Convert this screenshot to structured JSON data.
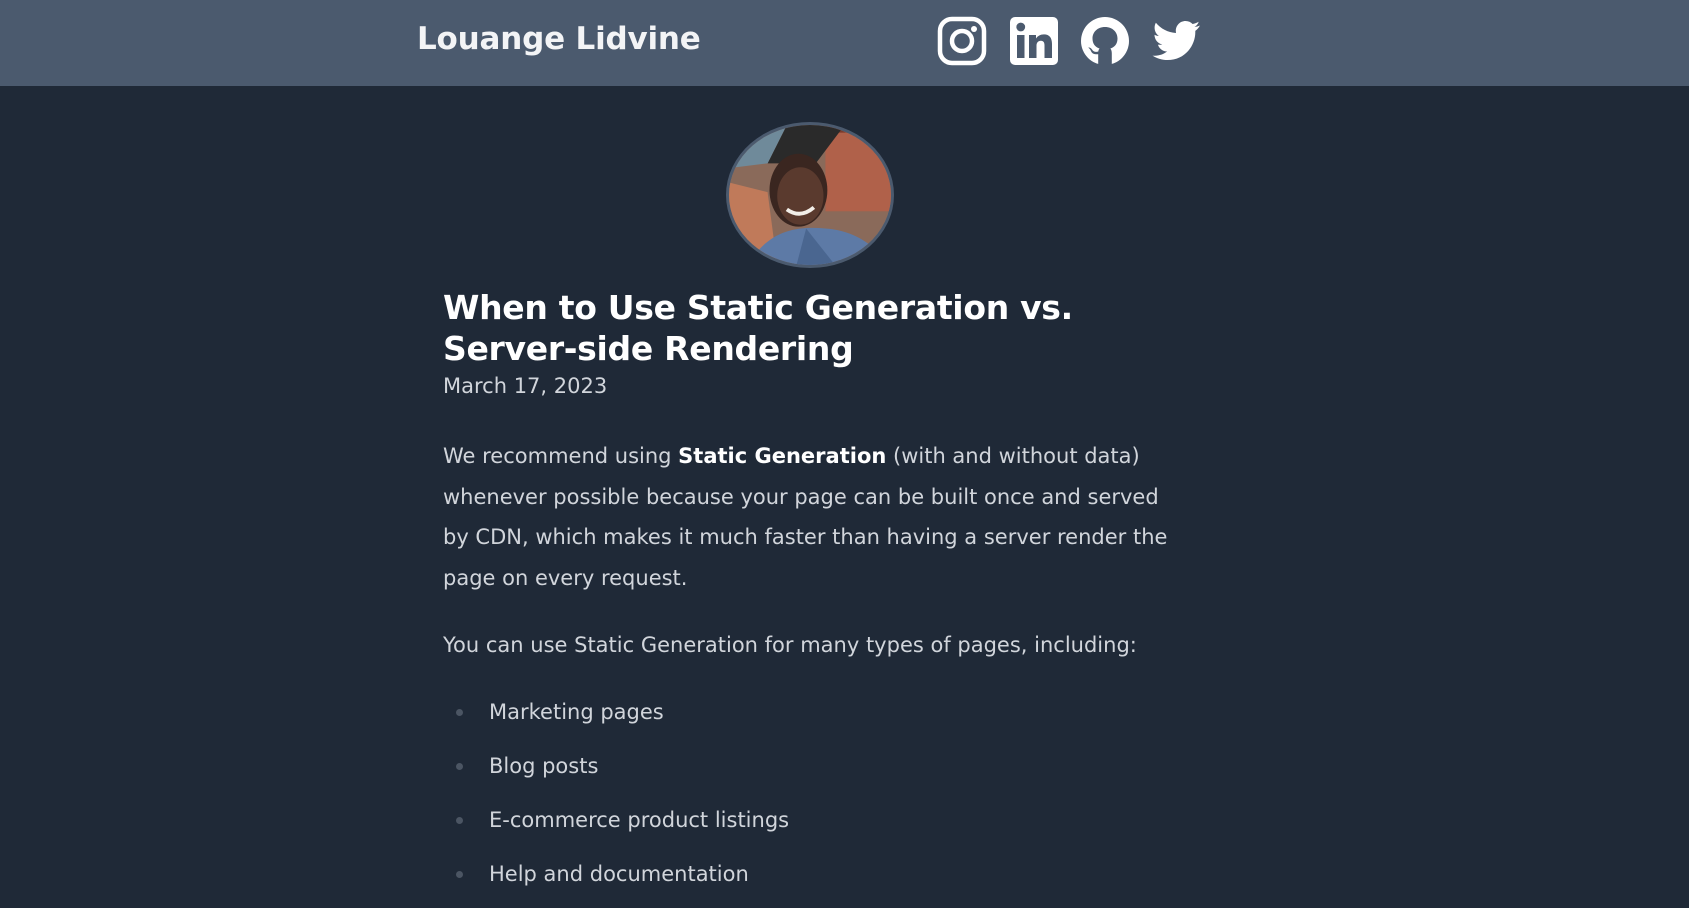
{
  "header": {
    "site_title": "Louange Lidvine",
    "social": [
      {
        "icon": "instagram-icon"
      },
      {
        "icon": "linkedin-icon"
      },
      {
        "icon": "github-icon"
      },
      {
        "icon": "twitter-icon"
      }
    ]
  },
  "post": {
    "title": "When to Use Static Generation vs. Server-side Rendering",
    "date": "March 17, 2023",
    "paragraph1": {
      "before": "We recommend using ",
      "bold": "Static Generation",
      "after": " (with and without data) whenever possible because your page can be built once and served by CDN, which makes it much faster than having a server render the page on every request."
    },
    "paragraph2": "You can use Static Generation for many types of pages, including:",
    "list": [
      "Marketing pages",
      "Blog posts",
      "E-commerce product listings",
      "Help and documentation"
    ]
  },
  "colors": {
    "background": "#1f2937",
    "header_bar": "#4b5a6e",
    "text": "#d1d5db",
    "heading": "#ffffff"
  }
}
